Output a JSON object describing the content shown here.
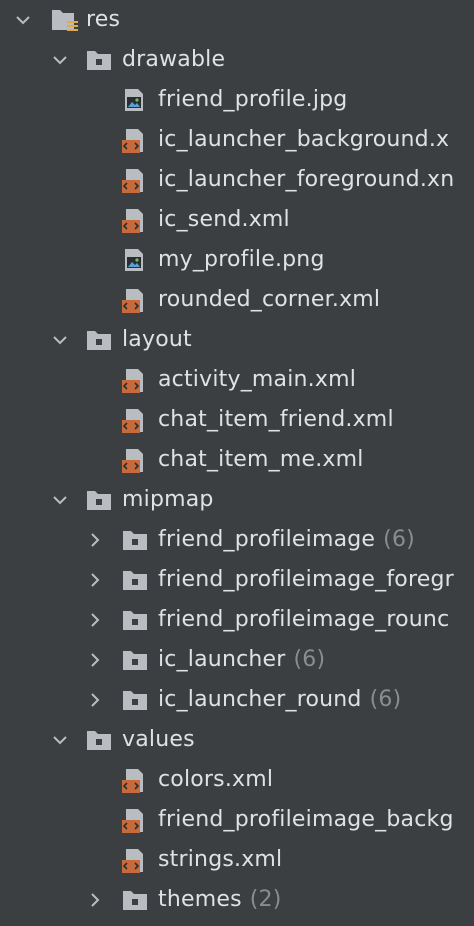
{
  "tree": {
    "root": {
      "label": "res"
    },
    "drawable": {
      "label": "drawable",
      "files": [
        {
          "label": "friend_profile.jpg",
          "icon": "image-file-icon"
        },
        {
          "label": "ic_launcher_background.x",
          "icon": "xml-file-icon"
        },
        {
          "label": "ic_launcher_foreground.xn",
          "icon": "xml-file-icon"
        },
        {
          "label": "ic_send.xml",
          "icon": "xml-file-icon"
        },
        {
          "label": "my_profile.png",
          "icon": "image-file-icon"
        },
        {
          "label": "rounded_corner.xml",
          "icon": "xml-file-icon"
        }
      ]
    },
    "layout": {
      "label": "layout",
      "files": [
        {
          "label": "activity_main.xml",
          "icon": "xml-file-icon"
        },
        {
          "label": "chat_item_friend.xml",
          "icon": "xml-file-icon"
        },
        {
          "label": "chat_item_me.xml",
          "icon": "xml-file-icon"
        }
      ]
    },
    "mipmap": {
      "label": "mipmap",
      "folders": [
        {
          "label": "friend_profileimage",
          "count": "(6)"
        },
        {
          "label": "friend_profileimage_foregr",
          "count": ""
        },
        {
          "label": "friend_profileimage_rounc",
          "count": ""
        },
        {
          "label": "ic_launcher",
          "count": "(6)"
        },
        {
          "label": "ic_launcher_round",
          "count": "(6)"
        }
      ]
    },
    "values": {
      "label": "values",
      "files": [
        {
          "label": "colors.xml",
          "icon": "xml-file-icon"
        },
        {
          "label": "friend_profileimage_backg",
          "icon": "xml-file-icon"
        },
        {
          "label": "strings.xml",
          "icon": "xml-file-icon"
        }
      ],
      "folders": [
        {
          "label": "themes",
          "count": "(2)"
        }
      ]
    }
  },
  "colors": {
    "background": "#3c3f41",
    "text": "#dfe1e5",
    "count_text": "#8c8c8c",
    "folder": "#b9bcc1",
    "xml_badge": "#c86b3c",
    "image_accent": "#5aa0d8"
  }
}
